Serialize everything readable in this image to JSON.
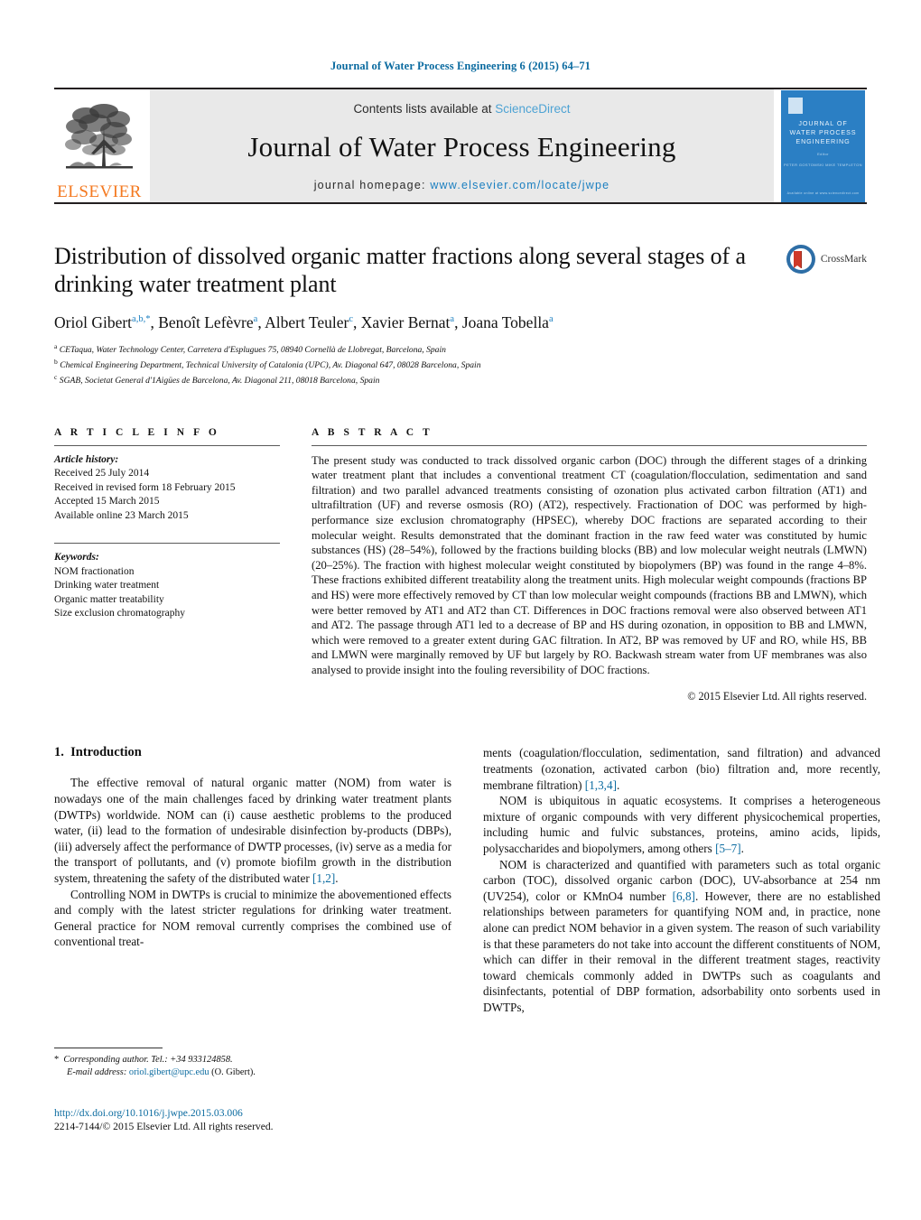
{
  "running_head": "Journal of Water Process Engineering 6 (2015) 64–71",
  "masthead": {
    "publisher_word": "ELSEVIER",
    "contents_prefix": "Contents lists available at ",
    "contents_link": "ScienceDirect",
    "journal_name": "Journal of Water Process Engineering",
    "homepage_prefix": "journal homepage: ",
    "homepage_url": "www.elsevier.com/locate/jwpe",
    "cover": {
      "line1": "JOURNAL OF",
      "line2": "WATER PROCESS",
      "line3": "ENGINEERING",
      "editor_label": "Editor",
      "editors": "PETER GOSTOMSKI   MIKE TEMPLETON",
      "footer": "Available online at www.sciencedirect.com"
    }
  },
  "article": {
    "title": "Distribution of dissolved organic matter fractions along several stages of a drinking water treatment plant",
    "crossmark_label": "CrossMark",
    "authors": [
      {
        "name": "Oriol Gibert",
        "marks": "a,b,*"
      },
      {
        "name": "Benoît Lefèvre",
        "marks": "a"
      },
      {
        "name": "Albert Teuler",
        "marks": "c"
      },
      {
        "name": "Xavier Bernat",
        "marks": "a"
      },
      {
        "name": "Joana Tobella",
        "marks": "a"
      }
    ],
    "affiliations": [
      {
        "mark": "a",
        "text": "CETaqua, Water Technology Center, Carretera d'Esplugues 75, 08940 Cornellà de Llobregat, Barcelona, Spain"
      },
      {
        "mark": "b",
        "text": "Chemical Engineering Department, Technical University of Catalonia (UPC), Av. Diagonal 647, 08028 Barcelona, Spain"
      },
      {
        "mark": "c",
        "text": "SGAB, Societat General d'1Aigües de Barcelona, Av. Diagonal 211, 08018 Barcelona, Spain"
      }
    ]
  },
  "article_info": {
    "heading": "A R T I C L E    I N F O",
    "history_label": "Article history:",
    "history": [
      "Received 25 July 2014",
      "Received in revised form 18 February 2015",
      "Accepted 15 March 2015",
      "Available online 23 March 2015"
    ],
    "keywords_label": "Keywords:",
    "keywords": [
      "NOM fractionation",
      "Drinking water treatment",
      "Organic matter treatability",
      "Size exclusion chromatography"
    ]
  },
  "abstract": {
    "heading": "A B S T R A C T",
    "text": "The present study was conducted to track dissolved organic carbon (DOC) through the different stages of a drinking water treatment plant that includes a conventional treatment CT (coagulation/flocculation, sedimentation and sand filtration) and two parallel advanced treatments consisting of ozonation plus activated carbon filtration (AT1) and ultrafiltration (UF) and reverse osmosis (RO) (AT2), respectively. Fractionation of DOC was performed by high-performance size exclusion chromatography (HPSEC), whereby DOC fractions are separated according to their molecular weight. Results demonstrated that the dominant fraction in the raw feed water was constituted by humic substances (HS) (28–54%), followed by the fractions building blocks (BB) and low molecular weight neutrals (LMWN) (20–25%). The fraction with highest molecular weight constituted by biopolymers (BP) was found in the range 4–8%. These fractions exhibited different treatability along the treatment units. High molecular weight compounds (fractions BP and HS) were more effectively removed by CT than low molecular weight compounds (fractions BB and LMWN), which were better removed by AT1 and AT2 than CT. Differences in DOC fractions removal were also observed between AT1 and AT2. The passage through AT1 led to a decrease of BP and HS during ozonation, in opposition to BB and LMWN, which were removed to a greater extent during GAC filtration. In AT2, BP was removed by UF and RO, while HS, BB and LMWN were marginally removed by UF but largely by RO. Backwash stream water from UF membranes was also analysed to provide insight into the fouling reversibility of DOC fractions.",
    "copyright": "© 2015 Elsevier Ltd. All rights reserved."
  },
  "introduction": {
    "section_number": "1.",
    "section_title": "Introduction",
    "left_p1_a": "The effective removal of natural organic matter (NOM) from water is nowadays one of the main challenges faced by drinking water treatment plants (DWTPs) worldwide. NOM can (i) cause aesthetic problems to the produced water, (ii) lead to the formation of undesirable disinfection by-products (DBPs), (iii) adversely affect the performance of DWTP processes, (iv) serve as a media for the transport of pollutants, and (v) promote biofilm growth in the distribution system, threatening the safety of the distributed water ",
    "left_p1_ref": "[1,2]",
    "left_p1_b": ".",
    "left_p2": "Controlling NOM in DWTPs is crucial to minimize the abovementioned effects and comply with the latest stricter regulations for drinking water treatment. General practice for NOM removal currently comprises the combined use of conventional treat-",
    "right_p1_a": "ments (coagulation/flocculation, sedimentation, sand filtration) and advanced treatments (ozonation, activated carbon (bio) filtration and, more recently, membrane filtration) ",
    "right_p1_ref": "[1,3,4]",
    "right_p1_b": ".",
    "right_p2_a": "NOM is ubiquitous in aquatic ecosystems. It comprises a heterogeneous mixture of organic compounds with very different physicochemical properties, including humic and fulvic substances, proteins, amino acids, lipids, polysaccharides and biopolymers, among others ",
    "right_p2_ref": "[5–7]",
    "right_p2_b": ".",
    "right_p3_a": "NOM is characterized and quantified with parameters such as total organic carbon (TOC), dissolved organic carbon (DOC), UV-absorbance at 254 nm (UV254), color or KMnO4 number ",
    "right_p3_ref": "[6,8]",
    "right_p3_b": ". However, there are no established relationships between parameters for quantifying NOM and, in practice, none alone can predict NOM behavior in a given system. The reason of such variability is that these parameters do not take into account the different constituents of NOM, which can differ in their removal in the different treatment stages, reactivity toward chemicals commonly added in DWTPs such as coagulants and disinfectants, potential of DBP formation, adsorbability onto sorbents used in DWTPs,"
  },
  "footer": {
    "corresponding_marker": "*",
    "corresponding_text": "Corresponding author. Tel.: +34 933124858.",
    "email_label": "E-mail address:",
    "email": "oriol.gibert@upc.edu",
    "email_suffix": "(O. Gibert).",
    "doi": "http://dx.doi.org/10.1016/j.jwpe.2015.03.006",
    "issn_line": "2214-7144/© 2015 Elsevier Ltd. All rights reserved."
  },
  "colors": {
    "link_blue": "#0b6ba0",
    "sciencedirect_blue": "#4ea3d4",
    "elsevier_orange": "#f47920",
    "cover_blue": "#2b7fc4",
    "masthead_gray": "#e9e9e9"
  }
}
